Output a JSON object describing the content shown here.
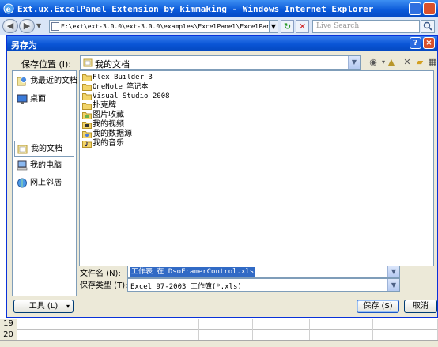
{
  "browser": {
    "title": "Ext.ux.ExcelPanel Extension by kimmaking - Windows Internet Explorer",
    "address": "E:\\ext\\ext-3.0.0\\ext-3.0.0\\examples\\ExcelPanel\\ExcelPanel.ht",
    "search_placeholder": "Live Search"
  },
  "excel": {
    "rows": [
      "19",
      "20"
    ]
  },
  "dialog": {
    "title": "另存为",
    "save_in_label": "保存位置 (I):",
    "save_in_value": "我的文档",
    "places": [
      {
        "label": "我最近的文档",
        "icon": "recent-docs-icon"
      },
      {
        "label": "桌面",
        "icon": "desktop-icon"
      },
      {
        "label": "我的文档",
        "icon": "my-documents-icon"
      },
      {
        "label": "我的电脑",
        "icon": "my-computer-icon"
      },
      {
        "label": "网上邻居",
        "icon": "network-icon"
      }
    ],
    "files": [
      {
        "name": "Flex Builder 3",
        "icon": "folder-icon"
      },
      {
        "name": "OneNote 笔记本",
        "icon": "folder-icon"
      },
      {
        "name": "Visual Studio 2008",
        "icon": "folder-icon"
      },
      {
        "name": "扑克牌",
        "icon": "folder-icon"
      },
      {
        "name": "图片收藏",
        "icon": "pictures-folder-icon"
      },
      {
        "name": "我的视频",
        "icon": "video-folder-icon"
      },
      {
        "name": "我的数据源",
        "icon": "datasource-folder-icon"
      },
      {
        "name": "我的音乐",
        "icon": "music-folder-icon"
      }
    ],
    "filename_label": "文件名 (N):",
    "filename_value": "工作表 在 DsoFramerControl.xls",
    "filetype_label": "保存类型 (T):",
    "filetype_value": "Excel 97-2003 工作簿(*.xls)",
    "tools_label": "工具 (L)",
    "save_label": "保存 (S)",
    "cancel_label": "取消"
  },
  "colors": {
    "xp_blue": "#0a55d6",
    "dialog_bg": "#ece9d8",
    "selection": "#316ac5"
  }
}
